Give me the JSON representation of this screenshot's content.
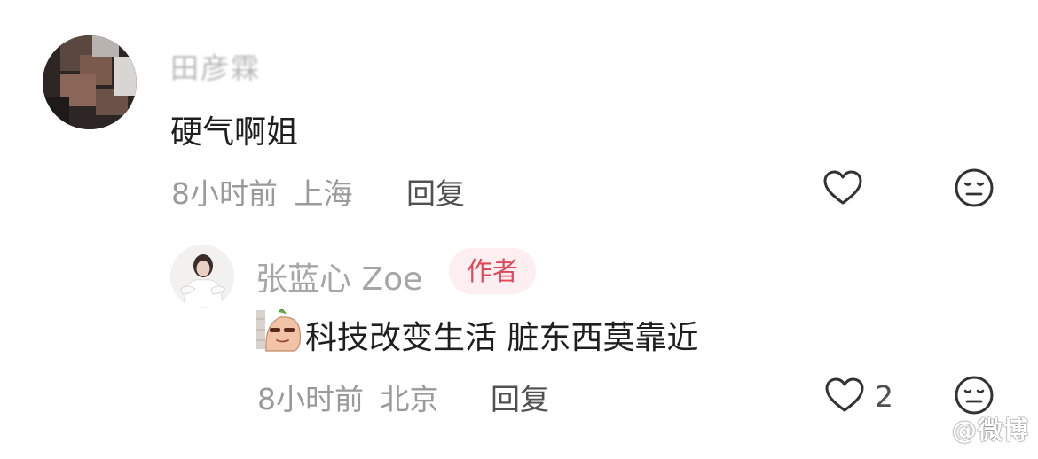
{
  "colors": {
    "username": "#b9b9b9",
    "comment_text": "#1f1f1f",
    "meta_text": "#9a9a9a",
    "reply_action": "#505050",
    "author_badge_bg": "#fdeef0",
    "author_badge_text": "#e0475a"
  },
  "comment": {
    "username": "田彦霖",
    "text": "硬气啊姐",
    "time": "8小时前",
    "location": "上海",
    "reply_label": "回复",
    "icons": {
      "like": "heart-icon",
      "dislike": "meh-face-icon"
    },
    "avatar": "blurred-profile-photo"
  },
  "reply": {
    "username": "张蓝心 Zoe",
    "badge": "作者",
    "sticker": "squinting-meme-sticker",
    "text": "科技改变生活 脏东西莫靠近",
    "time": "8小时前",
    "location": "北京",
    "reply_label": "回复",
    "like_count": "2",
    "icons": {
      "like": "heart-icon",
      "dislike": "meh-face-icon"
    },
    "avatar": "profile-photo-white-dress"
  },
  "watermark": "@微博"
}
